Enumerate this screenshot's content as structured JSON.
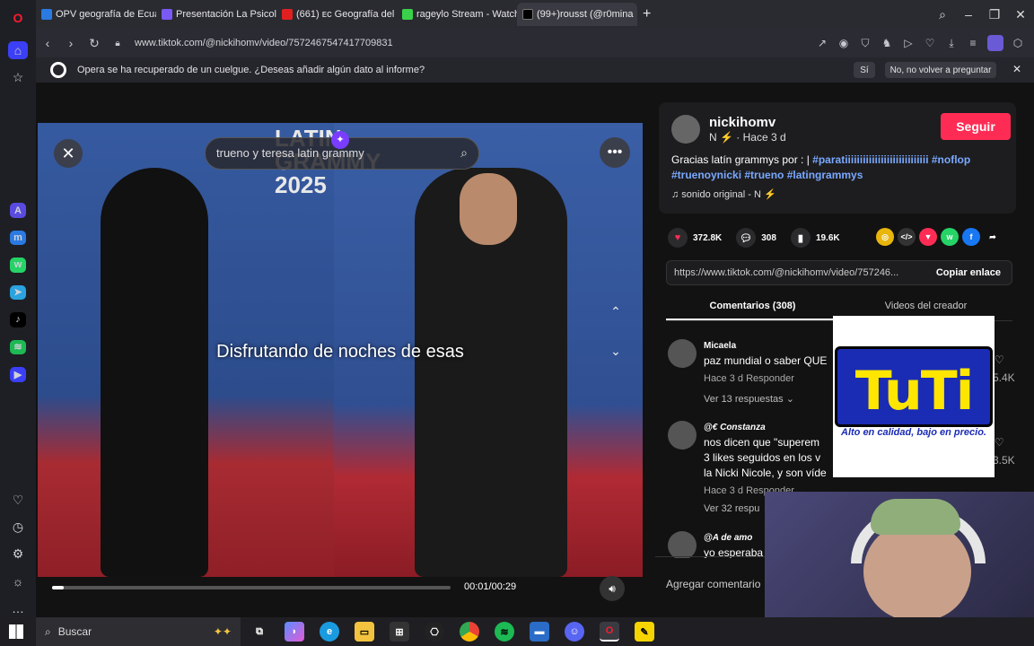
{
  "tabs": [
    {
      "label": "OPV geografía de Ecuador",
      "color": "#2a7ae2"
    },
    {
      "label": "Presentación La Psicologí",
      "color": "#7a5af5"
    },
    {
      "label": "(661) ᴇᴄ Geografía del Ecu",
      "color": "#e02020"
    },
    {
      "label": "rageylo Stream - Watch Li",
      "color": "#3ad14a"
    },
    {
      "label": "(99+)rousst (@r0mina",
      "color": "#000000"
    }
  ],
  "address": {
    "url": "www.tiktok.com/@nickihomv/video/7572467547417709831"
  },
  "infobar": {
    "message": "Opera se ha recuperado de un cuelgue. ¿Deseas añadir algún dato al informe?",
    "yes": "Sí",
    "no": "No, no volver a preguntar"
  },
  "video": {
    "search_value": "trueno y teresa latin grammy",
    "subtitle": "Disfrutando de noches de esas",
    "time": "00:01/00:29",
    "progress": 0.03,
    "backdrop_text": "LATIN GRAMMY 2025"
  },
  "creator": {
    "name": "nickihomv",
    "meta": "N ⚡ · Hace 3 d",
    "follow": "Seguir",
    "desc_prefix": "Gracias latín grammys por : |",
    "hashtags": "#paratiiiiiiiiiiiiiiiiiiiiiiiiiiii #noflop #truenoynicki #trueno #latingrammys",
    "sound": "♫ sonido original - N ⚡"
  },
  "stats": {
    "likes": "372.8K",
    "comments": "308",
    "saves": "19.6K"
  },
  "share": {
    "link": "https://www.tiktok.com/@nickihomv/video/757246...",
    "copy": "Copiar enlace"
  },
  "ctabs": {
    "comments": "Comentarios (308)",
    "creator": "Videos del creador"
  },
  "comments": [
    {
      "name": "Micaela",
      "text": "paz mundial o saber QUE",
      "meta": "Hace 3 d      Responder",
      "replies": "Ver 13 respuestas ⌄",
      "likes": "5.4K"
    },
    {
      "name": "@€ Constanza",
      "text": "nos dicen que \"superem\n3 likes seguidos en los v\nla Nicki Nicole, y son víde",
      "meta": "Hace 3 d      Responder",
      "replies": "Ver 32 respu",
      "likes": "3.5K"
    },
    {
      "name": "@A de amo",
      "text": "yo esperaba"
    }
  ],
  "add_comment": "Agregar comentario",
  "ad": {
    "logo": "TuTi",
    "tagline": "Alto en calidad, bajo en precio."
  },
  "taskbar": {
    "search": "Buscar"
  }
}
